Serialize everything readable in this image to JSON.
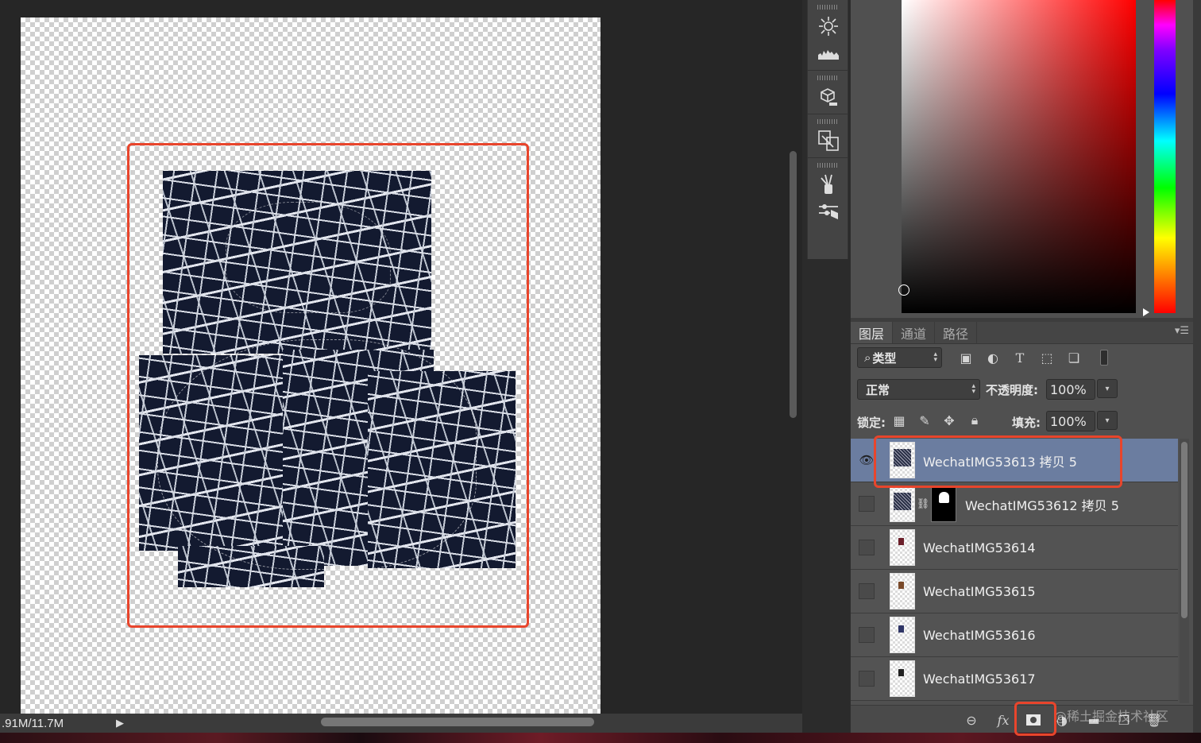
{
  "status_bar": {
    "doc_size": ".91M/11.7M",
    "arrow_icon": "play-triangle-icon"
  },
  "tools": [
    {
      "name": "light-sun-icon"
    },
    {
      "name": "histogram-icon"
    },
    {
      "name": "3d-cube-icon"
    },
    {
      "name": "transform-icon"
    },
    {
      "name": "brush-tool-icon"
    },
    {
      "name": "adjustments-icon"
    }
  ],
  "layers_panel": {
    "tabs": [
      "图层",
      "通道",
      "路径"
    ],
    "filter_kind": "类型",
    "filter_icons": [
      "image-icon",
      "adjustment-circle-icon",
      "type-T-icon",
      "shape-icon",
      "smart-object-icon",
      "toggle-icon"
    ],
    "blend_mode": "正常",
    "opacity_label": "不透明度:",
    "opacity_value": "100%",
    "lock_label": "锁定:",
    "fill_label": "填充:",
    "fill_value": "100%",
    "layers": [
      {
        "name": "WechatIMG53613 拷贝 5",
        "visible": true,
        "selected": true,
        "mask": false
      },
      {
        "name": "WechatIMG53612 拷贝 5",
        "visible": false,
        "selected": false,
        "mask": true
      },
      {
        "name": "WechatIMG53614",
        "visible": false,
        "selected": false,
        "mask": false
      },
      {
        "name": "WechatIMG53615",
        "visible": false,
        "selected": false,
        "mask": false
      },
      {
        "name": "WechatIMG53616",
        "visible": false,
        "selected": false,
        "mask": false
      },
      {
        "name": "WechatIMG53617",
        "visible": false,
        "selected": false,
        "mask": false
      }
    ],
    "footer_icons": [
      "link-layers-icon",
      "fx-icon",
      "add-mask-icon",
      "adjustment-layer-icon",
      "new-group-icon",
      "new-layer-icon",
      "trash-icon"
    ],
    "fx_label": "fx",
    "watermark": "@稀土掘金技术社区"
  },
  "colors": {
    "highlight": "#e8452c",
    "selected_layer": "#6b7da0",
    "fabric_dark": "#131a30"
  }
}
